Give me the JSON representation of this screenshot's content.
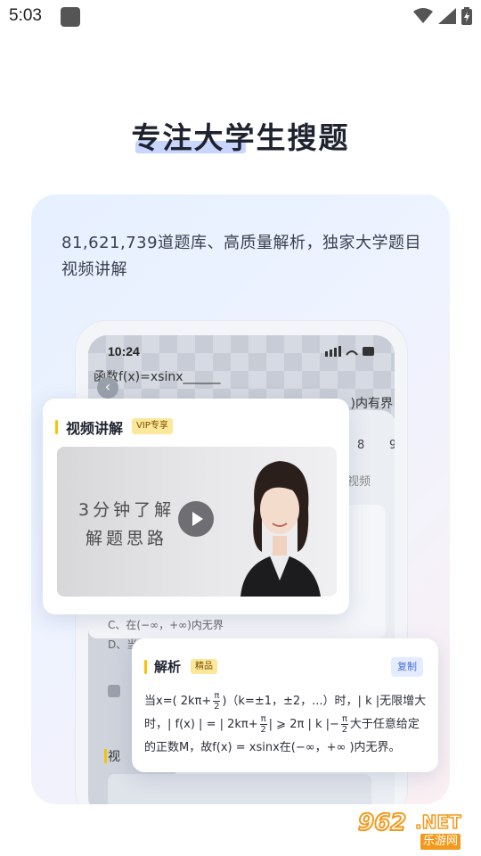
{
  "status_bar": {
    "time": "5:03",
    "icons": [
      "wifi-icon",
      "signal-icon",
      "battery-icon"
    ]
  },
  "headline": "专注大学生搜题",
  "description": "81,621,739道题库、高质量解析，独家大学题目视频讲解",
  "phone": {
    "time": "10:24",
    "question_line1": "函数f(x)=xsinx______",
    "question_line2": ")内有界",
    "tab_8": "8",
    "tab_9": "9",
    "video_tab": "点视频",
    "option_c": "C、在(−∞，+∞)内无界",
    "option_d": "D、当",
    "section_label": "视"
  },
  "video_card": {
    "title": "视频讲解",
    "badge": "VIP专享",
    "thumb_line1": "3分钟了解",
    "thumb_line2": "解题思路"
  },
  "answer_card": {
    "title": "解析",
    "badge": "精品",
    "copy_label": "复制",
    "line1_a": "当x=( 2kπ+",
    "line1_b": ")（k=±1，±2，...）时，| k |无限增大",
    "line2_a": "时，| f(x) | = | 2kπ+",
    "line2_b": "| ⩾ 2π | k |−",
    "line2_c": "大于任意给定",
    "line3": "的正数M，故f(x) = xsinx在(−∞，+∞ )内无界。",
    "frac_num": "π",
    "frac_den": "2"
  },
  "watermark": {
    "digits": "962",
    "suffix": ".NET",
    "text": "乐游网"
  },
  "colors": {
    "accent_yellow": "#f7c300",
    "badge_bg": "#fde79a",
    "headline_highlight": "#c8d6ff",
    "copy_blue": "#4a6ee0",
    "watermark_orange": "#f39a1e"
  }
}
